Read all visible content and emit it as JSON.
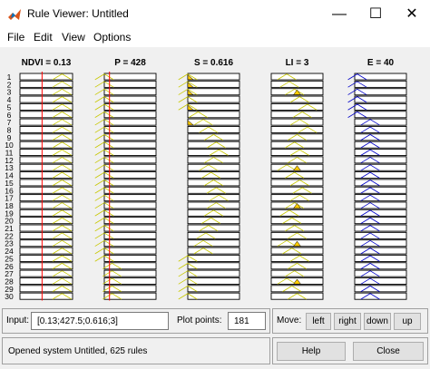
{
  "window": {
    "title": "Rule Viewer: Untitled",
    "icon": "matlab-icon"
  },
  "window_controls": {
    "minimize": "—",
    "maximize": "☐",
    "close": "✕"
  },
  "menu": [
    {
      "label": "File"
    },
    {
      "label": "Edit"
    },
    {
      "label": "View"
    },
    {
      "label": "Options"
    }
  ],
  "variables": [
    {
      "label": "NDVI = 0.13",
      "kind": "input"
    },
    {
      "label": "P = 428",
      "kind": "input"
    },
    {
      "label": "S = 0.616",
      "kind": "input"
    },
    {
      "label": "LI = 3",
      "kind": "input"
    },
    {
      "label": "E = 40",
      "kind": "output"
    }
  ],
  "row_labels": [
    "1",
    "2",
    "3",
    "4",
    "5",
    "6",
    "7",
    "8",
    "9",
    "10",
    "11",
    "12",
    "13",
    "14",
    "15",
    "16",
    "17",
    "18",
    "19",
    "20",
    "21",
    "22",
    "23",
    "24",
    "25",
    "26",
    "27",
    "28",
    "29",
    "30"
  ],
  "input_field": {
    "label": "Input:",
    "value": "[0.13;427.5;0.616;3]"
  },
  "plot_points": {
    "label": "Plot points:",
    "value": "181"
  },
  "move": {
    "label": "Move:",
    "buttons": [
      "left",
      "right",
      "down",
      "up"
    ]
  },
  "status": "Opened system Untitled, 625 rules",
  "help_button": "Help",
  "close_button": "Close",
  "colors": {
    "input_mf": "#c8c800",
    "fill_mf": "#ffcc00",
    "output_mf": "#0000c8",
    "indicator": "#ff0000"
  }
}
